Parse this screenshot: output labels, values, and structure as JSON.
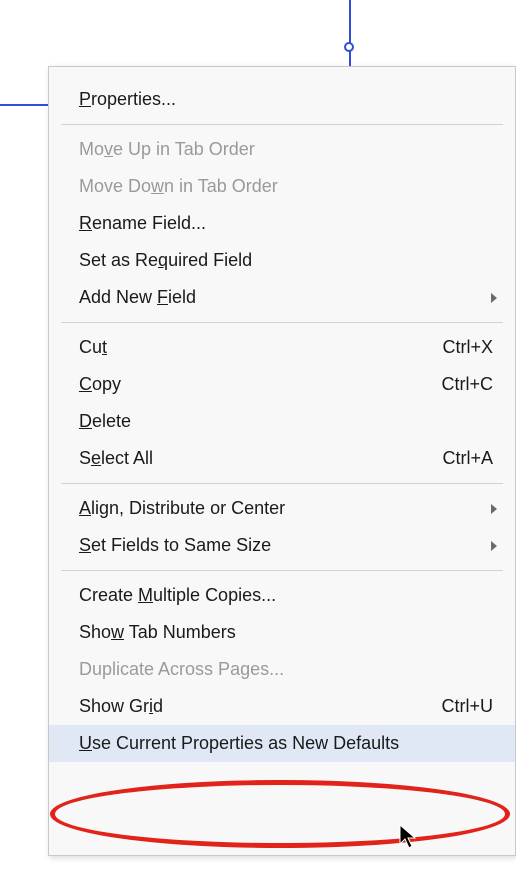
{
  "menu": {
    "properties": {
      "pre": "",
      "u": "P",
      "post": "roperties..."
    },
    "moveUp": {
      "pre": "Mo",
      "u": "v",
      "post": "e Up in Tab Order"
    },
    "moveDown": {
      "pre": "Move Do",
      "u": "w",
      "post": "n in Tab Order"
    },
    "rename": {
      "pre": "",
      "u": "R",
      "post": "ename Field..."
    },
    "setRequired": {
      "pre": "Set as Re",
      "u": "q",
      "post": "uired Field"
    },
    "addNewField": {
      "pre": "Add New ",
      "u": "F",
      "post": "ield"
    },
    "cut": {
      "pre": "Cu",
      "u": "t",
      "post": ""
    },
    "copy": {
      "pre": "",
      "u": "C",
      "post": "opy"
    },
    "delete": {
      "pre": "",
      "u": "D",
      "post": "elete"
    },
    "selectAll": {
      "pre": "S",
      "u": "e",
      "post": "lect All"
    },
    "align": {
      "pre": "",
      "u": "A",
      "post": "lign, Distribute or Center"
    },
    "sameSize": {
      "pre": "",
      "u": "S",
      "post": "et Fields to Same Size"
    },
    "multipleCopies": {
      "pre": "Create ",
      "u": "M",
      "post": "ultiple Copies..."
    },
    "showTabNumbers": {
      "pre": "Sho",
      "u": "w",
      "post": " Tab Numbers"
    },
    "duplicate": {
      "pre": "Duplicate Across Pa",
      "u": "g",
      "post": "es..."
    },
    "showGrid": {
      "pre": "Show Gr",
      "u": "i",
      "post": "d"
    },
    "useDefaults": {
      "pre": "",
      "u": "U",
      "post": "se Current Properties as New Defaults"
    }
  },
  "shortcuts": {
    "cut": "Ctrl+X",
    "copy": "Ctrl+C",
    "selectAll": "Ctrl+A",
    "showGrid": "Ctrl+U"
  }
}
